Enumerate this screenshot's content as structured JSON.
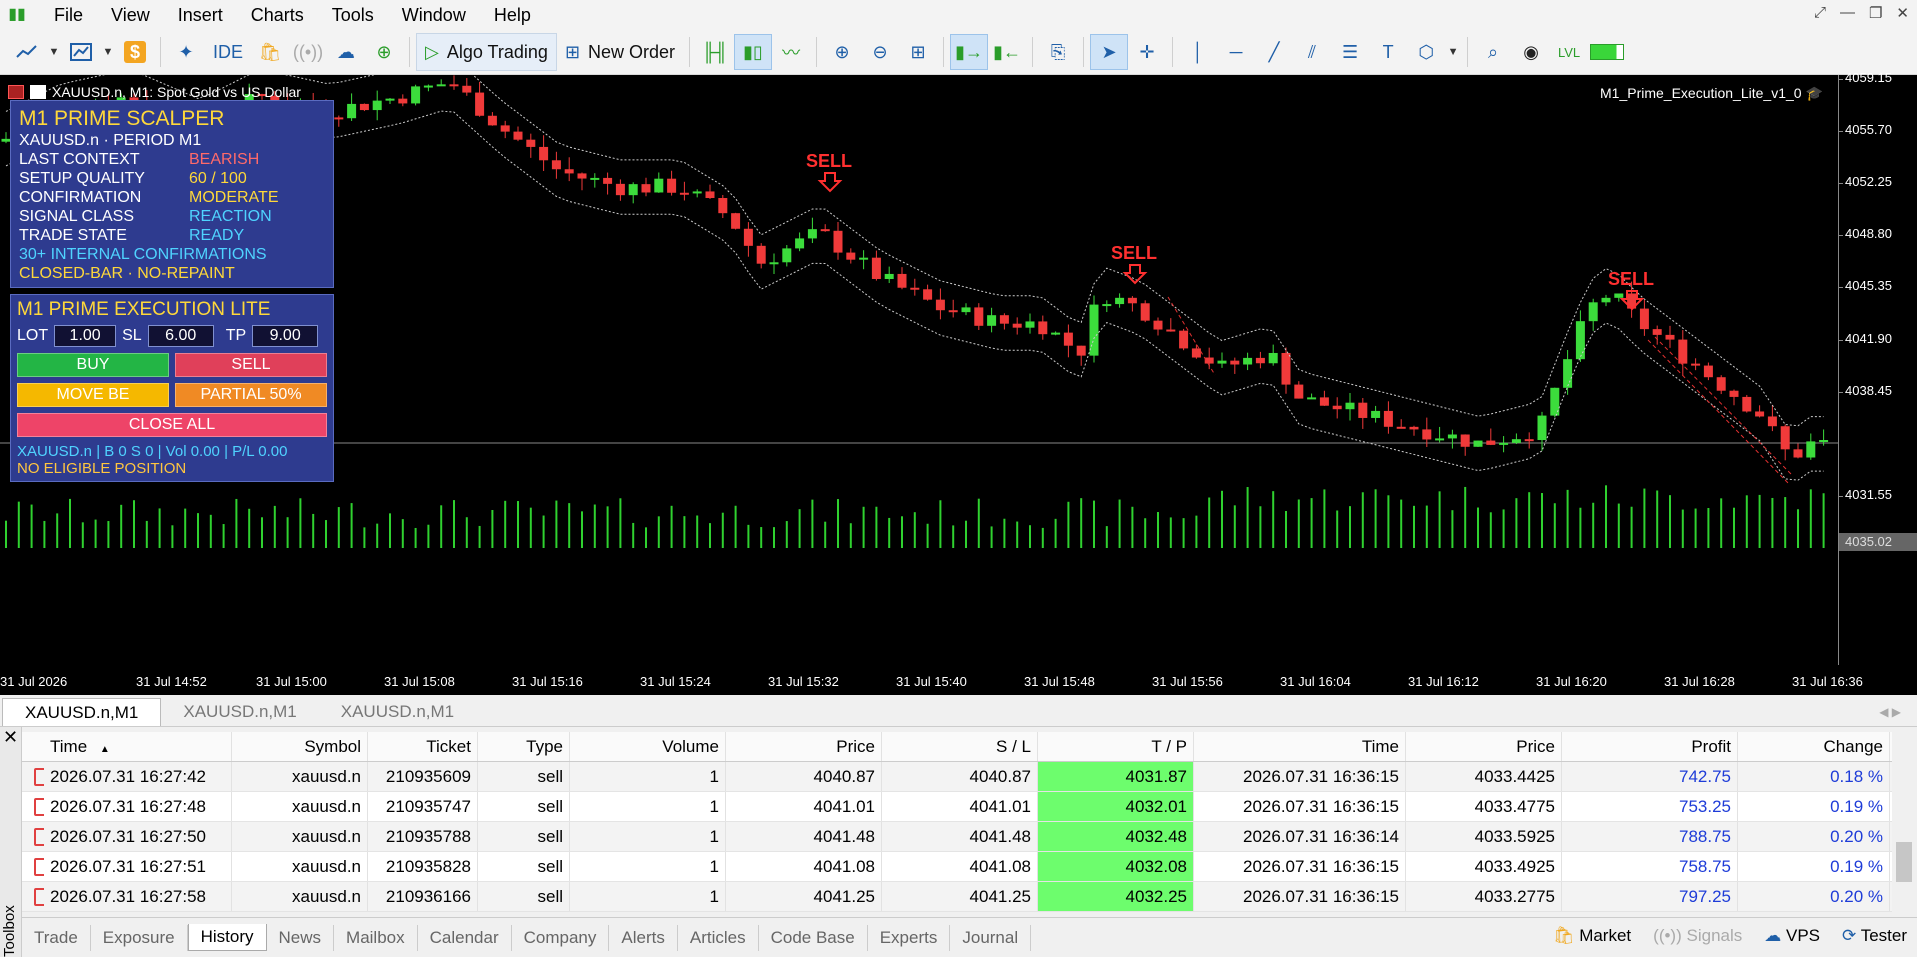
{
  "menu": [
    "File",
    "View",
    "Insert",
    "Charts",
    "Tools",
    "Window",
    "Help"
  ],
  "toolbar": {
    "ide": "IDE",
    "algo": "Algo Trading",
    "new_order": "New Order"
  },
  "chart": {
    "title": "XAUUSD.n, M1:  Spot Gold vs US Dollar",
    "ea_name": "M1_Prime_Execution_Lite_v1_0",
    "current_price": "4035.02",
    "price_labels": [
      "4059.15",
      "4055.70",
      "4052.25",
      "4048.80",
      "4045.35",
      "4041.90",
      "4038.45",
      "4031.55"
    ],
    "time_labels": [
      "31 Jul 2026",
      "31 Jul 14:52",
      "31 Jul 15:00",
      "31 Jul 15:08",
      "31 Jul 15:16",
      "31 Jul 15:24",
      "31 Jul 15:32",
      "31 Jul 15:40",
      "31 Jul 15:48",
      "31 Jul 15:56",
      "31 Jul 16:04",
      "31 Jul 16:12",
      "31 Jul 16:20",
      "31 Jul 16:28",
      "31 Jul 16:36"
    ],
    "sell_label": "SELL",
    "colors": {
      "bull": "#3cdc3c",
      "bear": "#f03a3a",
      "volume": "#2fd12f",
      "panel": "#2e3b8f"
    }
  },
  "scalper": {
    "title": "M1 PRIME SCALPER",
    "subtitle": "XAUUSD.n · PERIOD M1",
    "rows": [
      {
        "k": "LAST CONTEXT",
        "v": "BEARISH",
        "c": "#ff6a6a"
      },
      {
        "k": "SETUP QUALITY",
        "v": "60 / 100",
        "c": "#ffd83a"
      },
      {
        "k": "CONFIRMATION",
        "v": "MODERATE",
        "c": "#ffd83a"
      },
      {
        "k": "SIGNAL CLASS",
        "v": "REACTION",
        "c": "#4fd3ff"
      },
      {
        "k": "TRADE STATE",
        "v": "READY",
        "c": "#4fd3ff"
      }
    ],
    "note1": "30+ INTERNAL CONFIRMATIONS",
    "note2": "CLOSED-BAR · NO-REPAINT"
  },
  "execution": {
    "title": "M1 PRIME EXECUTION LITE",
    "lot_label": "LOT",
    "lot": "1.00",
    "sl_label": "SL",
    "sl": "6.00",
    "tp_label": "TP",
    "tp": "9.00",
    "buy": "BUY",
    "sell": "SELL",
    "move_be": "MOVE BE",
    "partial": "PARTIAL 50%",
    "close_all": "CLOSE ALL",
    "info1": "XAUUSD.n | B 0 S 0 | Vol 0.00 | P/L 0.00",
    "info2": "NO ELIGIBLE POSITION"
  },
  "chart_tabs": [
    "XAUUSD.n,M1",
    "XAUUSD.n,M1",
    "XAUUSD.n,M1"
  ],
  "table": {
    "headers": [
      "Time",
      "Symbol",
      "Ticket",
      "Type",
      "Volume",
      "Price",
      "S / L",
      "T / P",
      "Time",
      "Price",
      "Profit",
      "Change"
    ],
    "rows": [
      [
        "2026.07.31 16:27:42",
        "xauusd.n",
        "210935609",
        "sell",
        "1",
        "4040.87",
        "4040.87",
        "4031.87",
        "2026.07.31 16:36:15",
        "4033.4425",
        "742.75",
        "0.18 %"
      ],
      [
        "2026.07.31 16:27:48",
        "xauusd.n",
        "210935747",
        "sell",
        "1",
        "4041.01",
        "4041.01",
        "4032.01",
        "2026.07.31 16:36:15",
        "4033.4775",
        "753.25",
        "0.19 %"
      ],
      [
        "2026.07.31 16:27:50",
        "xauusd.n",
        "210935788",
        "sell",
        "1",
        "4041.48",
        "4041.48",
        "4032.48",
        "2026.07.31 16:36:14",
        "4033.5925",
        "788.75",
        "0.20 %"
      ],
      [
        "2026.07.31 16:27:51",
        "xauusd.n",
        "210935828",
        "sell",
        "1",
        "4041.08",
        "4041.08",
        "4032.08",
        "2026.07.31 16:36:15",
        "4033.4925",
        "758.75",
        "0.19 %"
      ],
      [
        "2026.07.31 16:27:58",
        "xauusd.n",
        "210936166",
        "sell",
        "1",
        "4041.25",
        "4041.25",
        "4032.25",
        "2026.07.31 16:36:15",
        "4033.2775",
        "797.25",
        "0.20 %"
      ]
    ]
  },
  "bottom_tabs": [
    "Trade",
    "Exposure",
    "History",
    "News",
    "Mailbox",
    "Calendar",
    "Company",
    "Alerts",
    "Articles",
    "Code Base",
    "Experts",
    "Journal"
  ],
  "active_bottom_tab": "History",
  "status": {
    "market": "Market",
    "signals": "Signals",
    "vps": "VPS",
    "tester": "Tester"
  },
  "toolbox_label": "Toolbox"
}
